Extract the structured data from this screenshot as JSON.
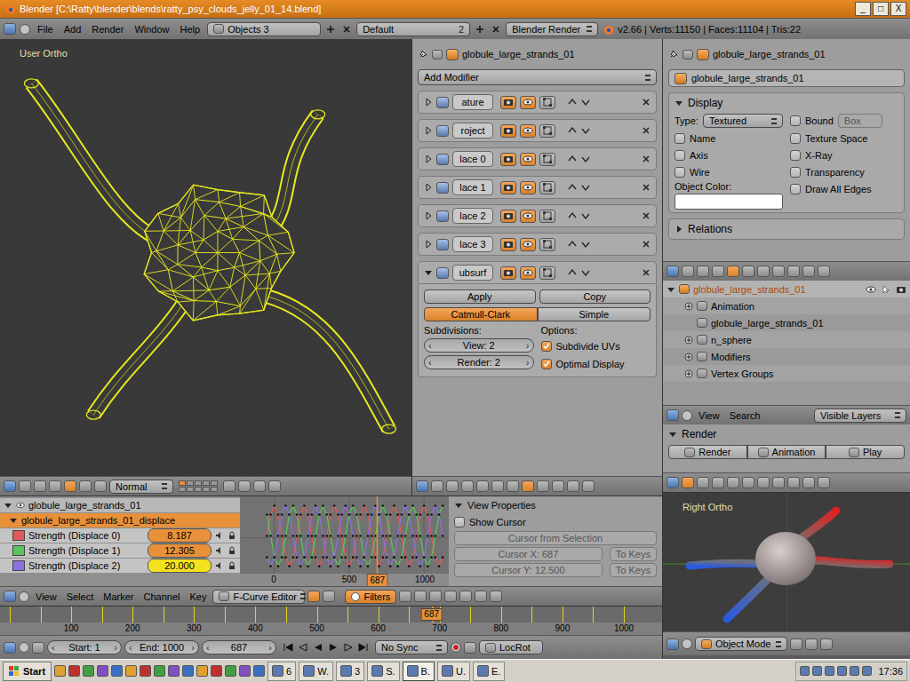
{
  "window": {
    "title": "Blender [C:\\Ratty\\blender\\blends\\ratty_psy_clouds_jelly_01_14.blend]",
    "controls": [
      "_",
      "□",
      "X"
    ]
  },
  "info_header": {
    "menus": [
      "File",
      "Add",
      "Render",
      "Window",
      "Help"
    ],
    "scene": "Objects 3",
    "screen": "Default",
    "screen_count": "2",
    "engine": "Blender Render",
    "stats": "v2.66 | Verts:11150 | Faces:11104 | Tris:22"
  },
  "viewport": {
    "label": "User Ortho",
    "pivot": "Normal"
  },
  "modifiers": {
    "breadcrumb": "globule_large_strands_01",
    "add": "Add Modifier",
    "stack": [
      {
        "name": "ature",
        "expanded": false,
        "render": true,
        "viewport": true,
        "editmode": false
      },
      {
        "name": "roject",
        "expanded": false,
        "render": true,
        "viewport": true,
        "editmode": false
      },
      {
        "name": "lace 0",
        "expanded": false,
        "render": true,
        "viewport": true,
        "editmode": false
      },
      {
        "name": "lace 1",
        "expanded": false,
        "render": true,
        "viewport": true,
        "editmode": false
      },
      {
        "name": "lace 2",
        "expanded": false,
        "render": true,
        "viewport": true,
        "editmode": false
      },
      {
        "name": "lace 3",
        "expanded": false,
        "render": true,
        "viewport": true,
        "editmode": false
      },
      {
        "name": "ubsurf",
        "expanded": true,
        "render": true,
        "viewport": true,
        "editmode": false
      }
    ],
    "subsurf": {
      "apply": "Apply",
      "copy": "Copy",
      "modes": [
        {
          "label": "Catmull-Clark",
          "selected": true
        },
        {
          "label": "Simple",
          "selected": false
        }
      ],
      "subdivisions_label": "Subdivisions:",
      "view": "View: 2",
      "render": "Render: 2",
      "options_label": "Options:",
      "options": [
        {
          "label": "Subdivide UVs",
          "checked": true
        },
        {
          "label": "Optimal Display",
          "checked": true
        }
      ]
    }
  },
  "properties": {
    "breadcrumb": "globule_large_strands_01",
    "name": "globule_large_strands_01",
    "display": {
      "title": "Display",
      "expanded": true,
      "type_label": "Type:",
      "type": "Textured",
      "bound": {
        "label": "Bound",
        "checked": false
      },
      "bound_type": "Box",
      "left": [
        {
          "label": "Name",
          "checked": false
        },
        {
          "label": "Axis",
          "checked": false
        },
        {
          "label": "Wire",
          "checked": false
        }
      ],
      "right": [
        {
          "label": "Texture Space",
          "checked": false
        },
        {
          "label": "X-Ray",
          "checked": false
        },
        {
          "label": "Transparency",
          "checked": false
        },
        {
          "label": "Draw All Edges",
          "checked": false
        }
      ],
      "color_label": "Object Color:",
      "color": "#ffffff"
    },
    "relations": {
      "title": "Relations",
      "expanded": false
    }
  },
  "outliner": {
    "rows": [
      {
        "label": "globule_large_strands_01",
        "depth": 0,
        "has_children": true,
        "expanded": true,
        "selected": true
      },
      {
        "label": "Animation",
        "depth": 1,
        "has_children": true,
        "expanded": false,
        "selected": false
      },
      {
        "label": "globule_large_strands_01",
        "depth": 1,
        "has_children": false,
        "expanded": false,
        "selected": false
      },
      {
        "label": "n_sphere",
        "depth": 1,
        "has_children": true,
        "expanded": false,
        "selected": false
      },
      {
        "label": "Modifiers",
        "depth": 1,
        "has_children": true,
        "expanded": false,
        "selected": false
      },
      {
        "label": "Vertex Groups",
        "depth": 1,
        "has_children": true,
        "expanded": false,
        "selected": false
      }
    ],
    "menus": [
      "View",
      "Search"
    ],
    "filter": "Visible Layers"
  },
  "render": {
    "title": "Render",
    "buttons": [
      "Render",
      "Animation",
      "Play"
    ]
  },
  "right_view": {
    "label": "Right Ortho"
  },
  "channels": {
    "object": "globule_large_strands_01",
    "action": "globule_large_strands_01_displace",
    "items": [
      {
        "name": "Strength (Displace 0)",
        "value": "8.187",
        "color": "#e05a5a",
        "selected": false
      },
      {
        "name": "Strength (Displace 1)",
        "value": "12.305",
        "color": "#5cc25c",
        "selected": false
      },
      {
        "name": "Strength (Displace 2)",
        "value": "20.000",
        "color": "#8a70e0",
        "selected": true
      }
    ]
  },
  "graph": {
    "ticks": [
      "0",
      "500",
      "1000"
    ],
    "frame": "687",
    "start_frame": -50,
    "frame_step": 25,
    "series": [
      {
        "color": "#e05a5a",
        "values": [
          12.5,
          17.8,
          20,
          17.8,
          12.5,
          7.2,
          5,
          7.2,
          12.5,
          17.8,
          20,
          17.8,
          12.5,
          7.2,
          5,
          7.2,
          12.5,
          17.8,
          20,
          17.8,
          12.5,
          7.2,
          5,
          7.2,
          12.5,
          17.8,
          20,
          17.8,
          12.5,
          7.2,
          5,
          7.2,
          12.5,
          17.8,
          20,
          17.8,
          12.5,
          7.2,
          5,
          7.2,
          12.5,
          17.8,
          20,
          17.8,
          12.5,
          7.2,
          5,
          7.2
        ]
      },
      {
        "color": "#5cc25c",
        "values": [
          17.8,
          12.5,
          7.2,
          5,
          7.2,
          12.5,
          17.8,
          20,
          17.8,
          12.5,
          7.2,
          5,
          7.2,
          12.5,
          17.8,
          20,
          17.8,
          12.5,
          7.2,
          5,
          7.2,
          12.5,
          17.8,
          20,
          17.8,
          12.5,
          7.2,
          5,
          7.2,
          12.5,
          17.8,
          20,
          17.8,
          12.5,
          7.2,
          5,
          7.2,
          12.5,
          17.8,
          20,
          17.8,
          12.5,
          7.2,
          5,
          7.2,
          12.5,
          17.8,
          20
        ]
      },
      {
        "color": "#8a70e0",
        "values": [
          7.2,
          5,
          7.2,
          12.5,
          17.8,
          20,
          17.8,
          12.5,
          7.2,
          5,
          7.2,
          12.5,
          17.8,
          20,
          17.8,
          12.5,
          7.2,
          5,
          7.2,
          12.5,
          17.8,
          20,
          17.8,
          12.5,
          7.2,
          5,
          7.2,
          12.5,
          17.8,
          20,
          17.8,
          12.5,
          7.2,
          5,
          7.2,
          12.5,
          17.8,
          20,
          17.8,
          12.5,
          7.2,
          5,
          7.2,
          12.5,
          17.8,
          20,
          17.8,
          12.5
        ]
      }
    ]
  },
  "view_properties": {
    "title": "View Properties",
    "expanded": true,
    "show_cursor": {
      "label": "Show Cursor",
      "checked": false
    },
    "from_selection": "Cursor from Selection",
    "rows": [
      {
        "field": "Cursor X: 687",
        "button": "To Keys"
      },
      {
        "field": "Cursor Y: 12.500",
        "button": "To Keys"
      }
    ],
    "disabled": true
  },
  "graph_header": {
    "menus": [
      "View",
      "Select",
      "Marker",
      "Channel",
      "Key"
    ],
    "mode": "F-Curve Editor",
    "filters": {
      "label": "Filters",
      "on": true
    }
  },
  "timeline": {
    "ticks": [
      "100",
      "200",
      "300",
      "400",
      "500",
      "600",
      "700",
      "800",
      "900",
      "1000"
    ],
    "current": "687",
    "keyframes": [
      0,
      50,
      100,
      150,
      200,
      250,
      300,
      350,
      400,
      450,
      500,
      550,
      600,
      650,
      700,
      750,
      800,
      850,
      900,
      950,
      1000
    ]
  },
  "timeline_header": {
    "start": "Start: 1",
    "end": "End: 1000",
    "frame": "687",
    "sync": "No Sync",
    "keying": "LocRot",
    "mode": "Object Mode"
  },
  "taskbar": {
    "start": "Start",
    "items": [
      {
        "label": "6",
        "active": false
      },
      {
        "label": "W.",
        "active": false
      },
      {
        "label": "3",
        "active": false
      },
      {
        "label": "S.",
        "active": false
      },
      {
        "label": "B.",
        "active": true
      },
      {
        "label": "U.",
        "active": false
      },
      {
        "label": "E.",
        "active": false
      }
    ],
    "clock": "17:36"
  }
}
